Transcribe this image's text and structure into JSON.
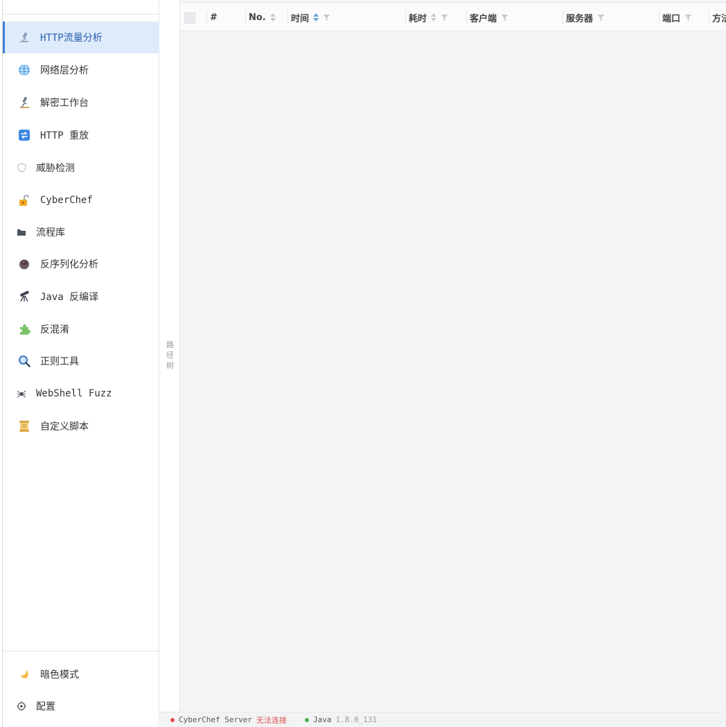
{
  "sidebar": {
    "items": [
      {
        "label": "HTTP流量分析",
        "icon": "microscope-icon",
        "active": true
      },
      {
        "label": "网络层分析",
        "icon": "globe-icon"
      },
      {
        "label": "解密工作台",
        "icon": "microscope-icon"
      },
      {
        "label": "HTTP 重放",
        "icon": "repeat-icon"
      },
      {
        "label": "威胁检测",
        "icon": "shield-icon"
      },
      {
        "label": "CyberChef",
        "icon": "unlock-icon"
      },
      {
        "label": "流程库",
        "icon": "folder-icon"
      },
      {
        "label": "反序列化分析",
        "icon": "coffee-icon"
      },
      {
        "label": "Java 反编译",
        "icon": "telescope-icon"
      },
      {
        "label": "反混淆",
        "icon": "puzzle-icon"
      },
      {
        "label": "正则工具",
        "icon": "magnifier-icon"
      },
      {
        "label": "WebShell Fuzz",
        "icon": "spider-icon"
      },
      {
        "label": "自定义脚本",
        "icon": "scroll-icon"
      }
    ],
    "bottom": [
      {
        "label": "暗色模式",
        "icon": "moon-icon"
      },
      {
        "label": "配置",
        "icon": "gear-icon"
      }
    ]
  },
  "splitter": {
    "label": "路径树"
  },
  "table": {
    "columns": [
      {
        "label": "#",
        "sortable": false,
        "filter": false
      },
      {
        "label": "No.",
        "sortable": true,
        "filter": false
      },
      {
        "label": "时间",
        "sortable": true,
        "sort_active": true,
        "filter": true
      },
      {
        "label": "耗时",
        "sortable": true,
        "filter": true
      },
      {
        "label": "客户端",
        "sortable": false,
        "filter": true
      },
      {
        "label": "服务器",
        "sortable": false,
        "filter": true
      },
      {
        "label": "端口",
        "sortable": false,
        "filter": true
      },
      {
        "label": "方法",
        "sortable": false,
        "filter": false
      }
    ]
  },
  "status": {
    "cyberchef_label": "CyberChef Server",
    "cyberchef_state": "无法连接",
    "cyberchef_color": "#e05252",
    "java_label": "Java",
    "java_version": "1.8.0_131",
    "java_color": "#4caf50"
  },
  "colors": {
    "accent": "#3f7fd6",
    "active_bg": "#deebfa"
  }
}
